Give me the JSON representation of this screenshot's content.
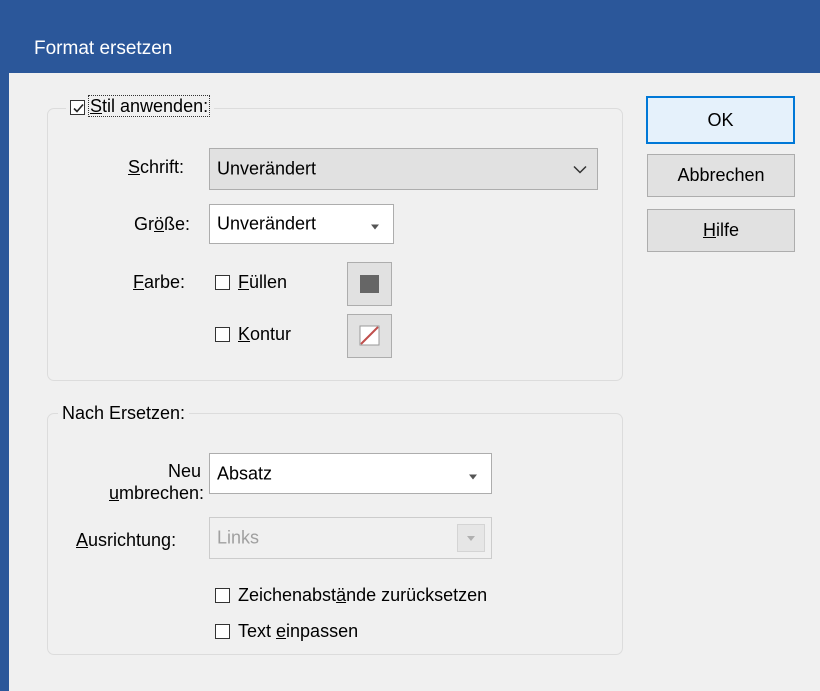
{
  "window": {
    "title": "Format ersetzen"
  },
  "style_group": {
    "checkbox_checked": true,
    "label_prefix": "S",
    "label_rest": "til anwenden:",
    "font": {
      "label_u": "S",
      "label_rest": "chrift:",
      "value": "Unverändert"
    },
    "size": {
      "label_pre": "Gr",
      "label_u": "ö",
      "label_rest": "ße:",
      "value": "Unverändert"
    },
    "color": {
      "label_u": "F",
      "label_rest": "arbe:",
      "fill": {
        "label_u": "F",
        "label_rest": "üllen",
        "checked": false,
        "swatch": "#666666"
      },
      "stroke": {
        "label_u": "K",
        "label_rest": "ontur",
        "checked": false,
        "swatch_line": "#c0504d"
      }
    }
  },
  "after_group": {
    "legend": "Nach Ersetzen:",
    "rewrap": {
      "line1": "Neu",
      "line2_u": "u",
      "line2_rest": "mbrechen:",
      "value": "Absatz"
    },
    "align": {
      "label_u": "A",
      "label_rest": "usrichtung:",
      "value": "Links",
      "disabled": true
    },
    "reset_spacing": {
      "label_pre": "Zeichenabst",
      "label_u": "ä",
      "label_rest": "nde zurücksetzen",
      "checked": false
    },
    "fit_text": {
      "label_pre": "Text ",
      "label_u": "e",
      "label_rest": "inpassen",
      "checked": false
    }
  },
  "buttons": {
    "ok": "OK",
    "cancel": "Abbrechen",
    "help_u": "H",
    "help_rest": "ilfe"
  }
}
